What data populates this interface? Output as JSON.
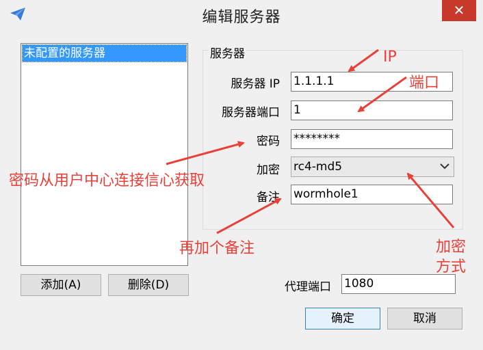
{
  "window": {
    "title": "编辑服务器",
    "close_glyph": "✕"
  },
  "server_list": {
    "items": [
      "未配置的服务器"
    ]
  },
  "buttons": {
    "add": "添加(A)",
    "delete": "删除(D)",
    "ok": "确定",
    "cancel": "取消"
  },
  "server_group": {
    "title": "服务器",
    "ip_label": "服务器 IP",
    "ip_value": "1.1.1.1",
    "port_label": "服务器端口",
    "port_value": "1",
    "password_label": "密码",
    "password_value": "********",
    "encryption_label": "加密",
    "encryption_value": "rc4-md5",
    "remark_label": "备注",
    "remark_value": "wormhole1"
  },
  "proxy": {
    "port_label": "代理端口",
    "port_value": "1080"
  },
  "annotations": {
    "ip": "IP",
    "port": "端口",
    "password": "密码从用户中心连接信心获取",
    "remark": "再加个备注",
    "encryption_line1": "加密",
    "encryption_line2": "方式"
  },
  "colors": {
    "accent": "#3399ff",
    "close": "#c7392b",
    "annotation": "#e8413a"
  }
}
